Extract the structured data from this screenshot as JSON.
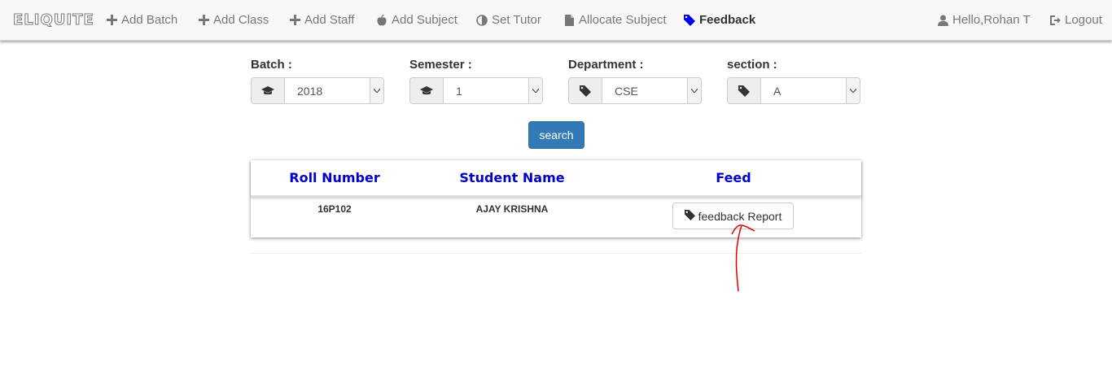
{
  "navbar": {
    "brand": "ELIQUITE",
    "items": [
      {
        "label": "Add Batch",
        "icon": "plus-icon"
      },
      {
        "label": "Add Class",
        "icon": "plus-icon"
      },
      {
        "label": "Add Staff",
        "icon": "plus-icon"
      },
      {
        "label": "Add Subject",
        "icon": "apple-icon"
      },
      {
        "label": "Set Tutor",
        "icon": "adjust-icon"
      },
      {
        "label": "Allocate Subject",
        "icon": "file-icon"
      },
      {
        "label": "Feedback",
        "icon": "tag-icon",
        "active": true
      }
    ],
    "user": {
      "label": "Hello,Rohan T",
      "icon": "user-icon"
    },
    "logout": {
      "label": "Logout",
      "icon": "logout-icon"
    },
    "active_color": "#0000ee"
  },
  "filters": [
    {
      "label": "Batch :",
      "value": "2018",
      "icon": "graduation-cap-icon"
    },
    {
      "label": "Semester :",
      "value": "1",
      "icon": "graduation-cap-icon"
    },
    {
      "label": "Department :",
      "value": "CSE",
      "icon": "tag-icon"
    },
    {
      "label": "section :",
      "value": "A",
      "icon": "tag-icon"
    }
  ],
  "search_label": "search",
  "table": {
    "headers": [
      "Roll Number",
      "Student Name",
      "Feed"
    ],
    "rows": [
      {
        "roll": "16P102",
        "name": "AJAY KRISHNA",
        "action": "feedback Report"
      }
    ],
    "header_color": "#0000cc"
  },
  "colors": {
    "primary": "#337ab7",
    "annotation": "#e00000"
  }
}
